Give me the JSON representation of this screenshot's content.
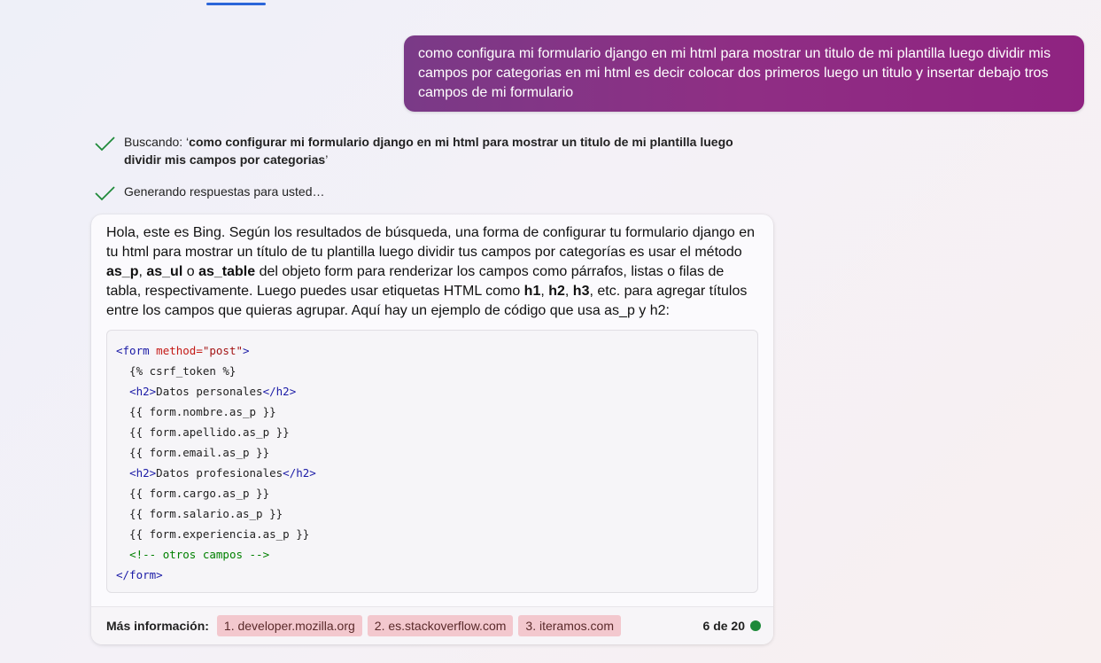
{
  "user_message": {
    "text": "como configura mi formulario django en mi html para mostrar un titulo de mi plantilla luego dividir mis campos por categorias en mi html es decir colocar dos primeros luego un titulo y insertar debajo tros campos de mi formulario"
  },
  "status": {
    "searching_prefix": "Buscando: ‘",
    "searching_query": "como configurar mi formulario django en mi html para mostrar un titulo de mi plantilla luego dividir mis campos por categorias",
    "searching_suffix": "’",
    "generating": "Generando respuestas para usted…"
  },
  "bot": {
    "p1": "Hola, este es Bing. Según los resultados de búsqueda, una forma de configurar tu formulario django en tu html para mostrar un título de tu plantilla luego dividir tus campos por categorías es usar el método ",
    "m1": "as_p",
    "sep1": ", ",
    "m2": "as_ul",
    "sep2": " o ",
    "m3": "as_table",
    "p2": " del objeto form para renderizar los campos como párrafos, listas o filas de tabla, respectivamente. Luego puedes usar etiquetas HTML como ",
    "h1": "h1",
    "sep3": ", ",
    "h2": "h2",
    "sep4": ", ",
    "h3": "h3",
    "p3": ", etc. para agregar títulos entre los campos que quieras agrupar. Aquí hay un ejemplo de código que usa as_p y h2:"
  },
  "code": {
    "l1_open": "<form",
    "l1_attr": " method=",
    "l1_val": "\"post\"",
    "l1_close": ">",
    "l2": "  {% csrf_token %}",
    "l3_indent": "  ",
    "l3_open": "<h2>",
    "l3_text": "Datos personales",
    "l3_close": "</h2>",
    "l4": "  {{ form.nombre.as_p }}",
    "l5": "  {{ form.apellido.as_p }}",
    "l6": "  {{ form.email.as_p }}",
    "l7_indent": "  ",
    "l7_open": "<h2>",
    "l7_text": "Datos profesionales",
    "l7_close": "</h2>",
    "l8": "  {{ form.cargo.as_p }}",
    "l9": "  {{ form.salario.as_p }}",
    "l10": "  {{ form.experiencia.as_p }}",
    "l11_indent": "  ",
    "l11_comment": "<!-- otros campos -->",
    "l12": "</form>"
  },
  "footer": {
    "more_info_label": "Más información:",
    "sources": [
      "1. developer.mozilla.org",
      "2. es.stackoverflow.com",
      "3. iteramos.com"
    ],
    "turn_counter": "6 de 20"
  },
  "colors": {
    "user_bubble": "#8f2e84",
    "check": "#1f8a3a",
    "source_chip": "#f3c8ce",
    "turn_dot": "#1d8a3a"
  }
}
